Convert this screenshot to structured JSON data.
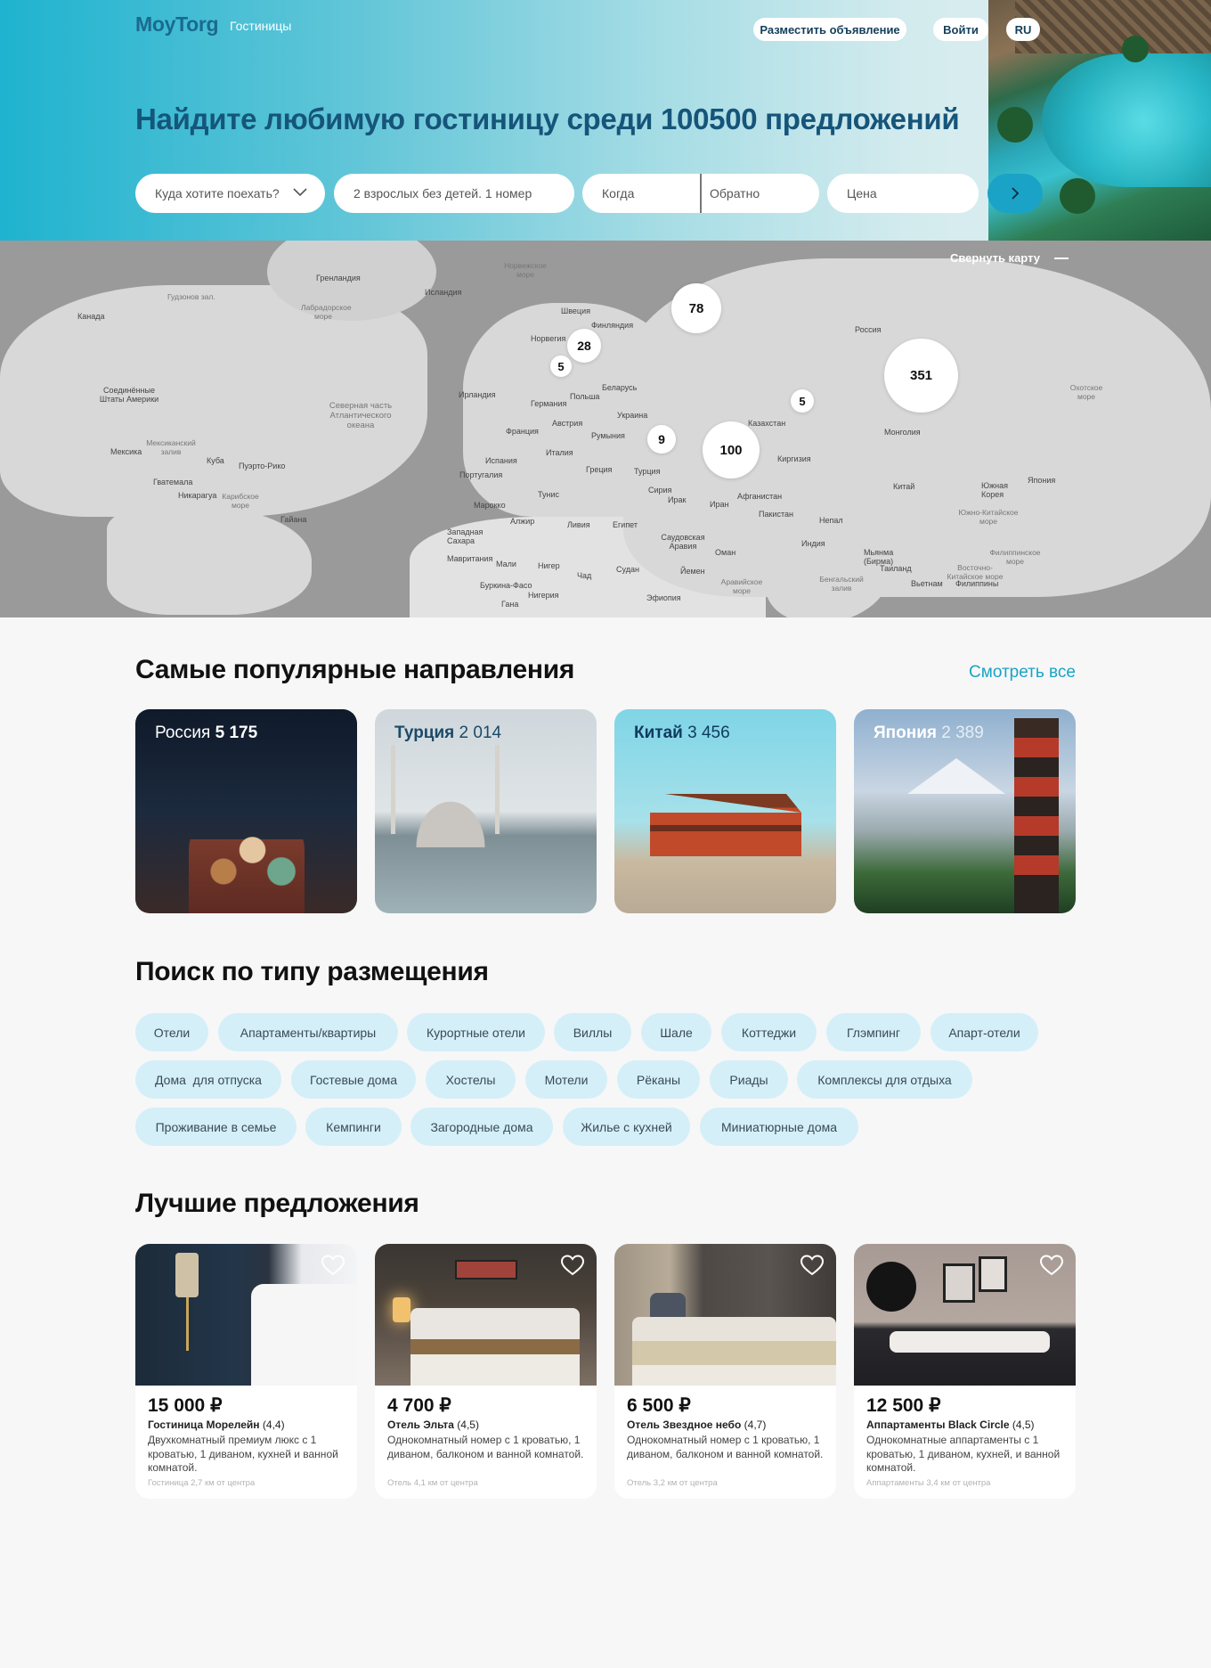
{
  "header": {
    "logo": "MoyTorg",
    "logo_sub": "Гостиницы",
    "post_ad": "Разместить объявление",
    "login": "Войти",
    "lang": "RU",
    "title": "Найдите любимую гостиницу среди 100500 предложений"
  },
  "search": {
    "destination": "Куда хотите поехать?",
    "guests": "2 взрослых без детей. 1 номер",
    "checkin": "Когда",
    "checkout": "Обратно",
    "price": "Цена"
  },
  "map": {
    "collapse_label": "Свернуть карту",
    "markers": [
      "78",
      "28",
      "5",
      "351",
      "5",
      "9",
      "100"
    ],
    "labels": {
      "greenland": "Гренландия",
      "iceland": "Исландия",
      "canada": "Канада",
      "usa": "Соединённые Штаты Америки",
      "mexico": "Мексика",
      "cuba": "Куба",
      "puerto_rico": "Пуэрто-Рико",
      "guatemala": "Гватемала",
      "nicaragua": "Никарагуа",
      "guyana": "Гайана",
      "sweden": "Швеция",
      "finland": "Финляндия",
      "norway": "Норвегия",
      "ireland": "Ирландия",
      "germany": "Германия",
      "poland": "Польша",
      "belarus": "Беларусь",
      "ukraine": "Украина",
      "france": "Франция",
      "austria": "Австрия",
      "romania": "Румыния",
      "spain": "Испания",
      "italy": "Италия",
      "portugal": "Португалия",
      "greece": "Греция",
      "turkey": "Турция",
      "tunisia": "Тунис",
      "morocco": "Марокко",
      "algeria": "Алжир",
      "libya": "Ливия",
      "egypt": "Египет",
      "western_sahara": "Западная Сахара",
      "mauritania": "Мавритания",
      "mali": "Мали",
      "niger": "Нигер",
      "chad": "Чад",
      "sudan": "Судан",
      "burkina": "Буркина-Фасо",
      "nigeria": "Нигерия",
      "ghana": "Гана",
      "ethiopia": "Эфиопия",
      "yemen": "Йемен",
      "oman": "Оман",
      "saudi": "Саудовская Аравия",
      "syria": "Сирия",
      "iraq": "Ирак",
      "iran": "Иран",
      "afghanistan": "Афганистан",
      "pakistan": "Пакистан",
      "kazakhstan": "Казахстан",
      "kyrgyzstan": "Киргизия",
      "russia": "Россия",
      "mongolia": "Монголия",
      "china": "Китай",
      "nepal": "Непал",
      "india": "Индия",
      "myanmar": "Мьянма (Бирма)",
      "thailand": "Таиланд",
      "vietnam": "Вьетнам",
      "philippines": "Филиппины",
      "south_korea": "Южная Корея",
      "japan": "Япония",
      "atlantic": "Северная часть Атлантического океана",
      "hudson": "Гудзонов зал.",
      "labrador": "Лабрадорское море",
      "mexican_gulf": "Мексиканский залив",
      "caribbean": "Карибское море",
      "norwegian": "Норвежское море",
      "arabian": "Аравийское море",
      "bengal": "Бенгальский залив",
      "okhotsk": "Охотское море",
      "scs": "Южно-Китайское море",
      "pss": "Филиппинское море",
      "ecs": "Восточно-Китайское море"
    }
  },
  "popular": {
    "title": "Самые популярные направления",
    "see_all": "Смотреть все",
    "items": [
      {
        "country": "Россия",
        "count": "5 175"
      },
      {
        "country": "Турция",
        "count": "2 014"
      },
      {
        "country": "Китай",
        "count": "3 456"
      },
      {
        "country": "Япония",
        "count": "2 389"
      }
    ]
  },
  "types": {
    "title": "Поиск по типу размещения",
    "chips": [
      "Отели",
      "Апартаменты/квартиры",
      "Курортные отели",
      "Виллы",
      "Шале",
      "Коттеджи",
      "Глэмпинг",
      "Апарт-отели",
      "Дома  для отпуска",
      "Гостевые дома",
      "Хостелы",
      "Мотели",
      "Рёканы",
      "Риады",
      "Комплексы для отдыха",
      "Проживание в семье",
      "Кемпинги",
      "Загородные дома",
      "Жилье с кухней",
      "Миниатюрные дома"
    ]
  },
  "offers": {
    "title": "Лучшие предложения",
    "items": [
      {
        "price": "15 000 ₽",
        "name": "Гостиница Морелейн",
        "rating": "(4,4)",
        "desc": "Двухкомнатный премиум люкс с 1 кроватью, 1 диваном, кухней и ванной комнатой.",
        "meta": "Гостиница 2,7 км от центра"
      },
      {
        "price": "4 700 ₽",
        "name": "Отель Эльта",
        "rating": "(4,5)",
        "desc": "Однокомнатный номер с 1 кроватью, 1 диваном, балконом и ванной комнатой.",
        "meta": "Отель 4,1 км от центра"
      },
      {
        "price": "6 500 ₽",
        "name": "Отель Звездное небо",
        "rating": "(4,7)",
        "desc": "Однокомнатный номер с 1 кроватью, 1 диваном, балконом и ванной комнатой.",
        "meta": "Отель 3,2 км от центра"
      },
      {
        "price": "12 500 ₽",
        "name": "Аппартаменты Black Circle",
        "rating": "(4,5)",
        "desc": "Однокомнатные аппартаменты с 1 кроватью, 1 диваном, кухней, и ванной комнатой.",
        "meta": "Аппартаменты 3,4 км от центра"
      }
    ]
  },
  "colors": {
    "accent": "#1aa3c6",
    "chip": "#d4eff8",
    "title_blue": "#16557a"
  },
  "icons": [
    "chevron-down-icon",
    "arrow-right-icon",
    "minus-icon",
    "heart-icon"
  ]
}
